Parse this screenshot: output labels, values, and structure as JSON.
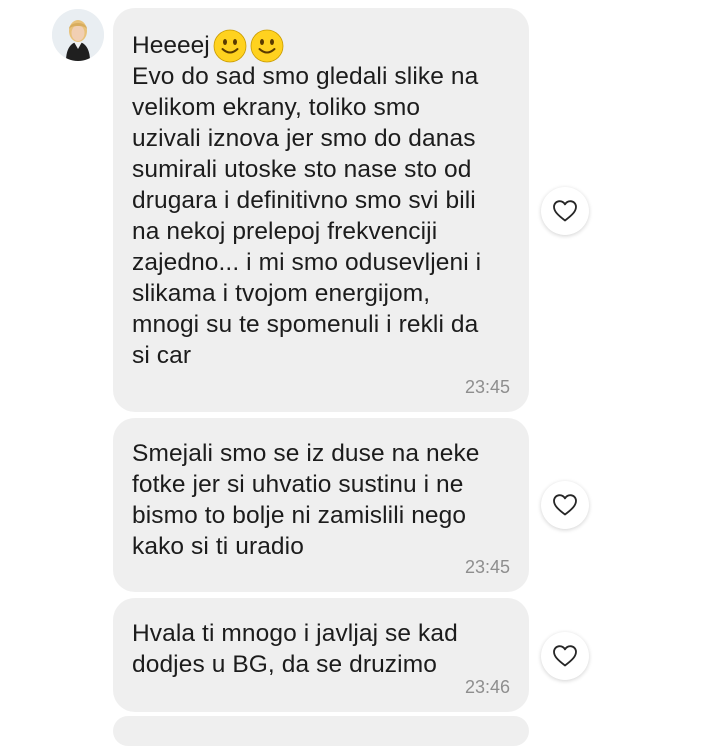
{
  "contact": {
    "avatar_icon": "profile-photo-avatar"
  },
  "messages": [
    {
      "greeting": "Heeeej",
      "emoji": [
        "slightly-smiling-face-icon",
        "slightly-smiling-face-icon"
      ],
      "text": "Evo do sad smo gledali slike na\nvelikom ekrany, toliko smo\nuzivali iznova jer smo do danas\nsumirali utoske sto nase sto od\ndrugara i definitivno smo svi bili\nna nekoj prelepoj frekvenciji\nzajedno... i mi smo odusevljeni i\nslikama i tvojom energijom,\nmnogi su te spomenuli i rekli da\nsi car",
      "time": "23:45"
    },
    {
      "text": "Smejali smo se iz duse na neke\nfotke jer si uhvatio sustinu i ne\nbismo to bolje ni zamislili nego\nkako si ti uradio",
      "time": "23:45"
    },
    {
      "text": "Hvala ti mnogo i javljaj se kad\ndodjes u BG, da se druzimo",
      "time": "23:46"
    }
  ],
  "like_icon": "heart-outline-icon",
  "colors": {
    "bubble": "#efefef",
    "timestamp": "#8e8e8e",
    "text": "#1c1c1c",
    "emoji_yellow": "#ffd21f"
  }
}
